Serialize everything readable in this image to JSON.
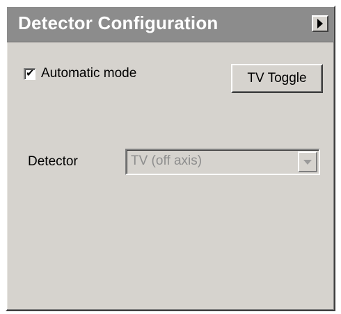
{
  "panel": {
    "title": "Detector Configuration",
    "collapse_icon": "triangle-right-icon"
  },
  "automatic_mode": {
    "label": "Automatic mode",
    "checked": true,
    "check_glyph": "✔"
  },
  "tv_toggle": {
    "label": "TV Toggle"
  },
  "detector": {
    "label": "Detector",
    "selected_value": "TV (off axis)",
    "enabled": false,
    "dropdown_icon": "chevron-down-icon"
  },
  "colors": {
    "panel_bg": "#d6d3ce",
    "titlebar_bg": "#8c8c8c",
    "title_text": "#ffffff",
    "disabled_text": "#8e8e8e"
  }
}
